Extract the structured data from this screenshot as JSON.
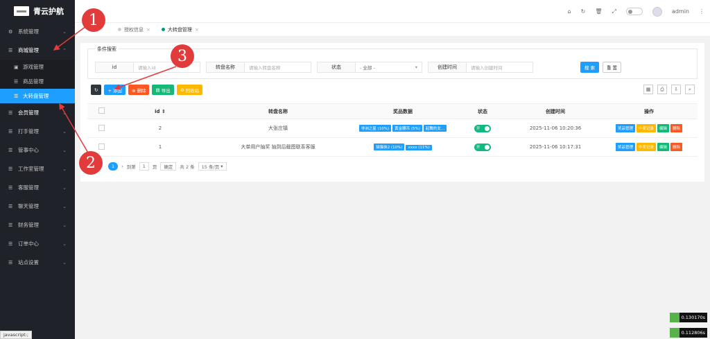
{
  "sidebar": {
    "title": "青云护航",
    "items": [
      {
        "label": "系统管理",
        "icon": "gear-icon"
      },
      {
        "label": "商城管理",
        "icon": "list-icon"
      },
      {
        "label": "会员管理",
        "icon": "list-icon"
      },
      {
        "label": "打手管理",
        "icon": "list-icon"
      },
      {
        "label": "管事中心",
        "icon": "list-icon"
      },
      {
        "label": "工作室管理",
        "icon": "list-icon"
      },
      {
        "label": "客服管理",
        "icon": "list-icon"
      },
      {
        "label": "聊天管理",
        "icon": "list-icon"
      },
      {
        "label": "财务管理",
        "icon": "list-icon"
      },
      {
        "label": "订单中心",
        "icon": "list-icon"
      },
      {
        "label": "站点设置",
        "icon": "list-icon"
      }
    ],
    "subitems": [
      {
        "label": "游戏管理"
      },
      {
        "label": "商品管理"
      },
      {
        "label": "大转盘管理"
      }
    ]
  },
  "topbar": {
    "user": "admin"
  },
  "tabs": [
    {
      "label": "授权信息"
    },
    {
      "label": "大转盘管理"
    }
  ],
  "search": {
    "legend": "条件搜索",
    "id_label": "id",
    "id_placeholder": "请输入id",
    "name_label": "转盘名称",
    "name_placeholder": "请输入转盘名称",
    "status_label": "状态",
    "status_value": "- 全部 -",
    "time_label": "创建时间",
    "time_placeholder": "请输入创建时间",
    "search_btn": "搜 索",
    "reset_btn": "重 置"
  },
  "toolbar": {
    "add": "+ 添加",
    "delete": "⊗ 删除",
    "export": "导出",
    "recycle": "回收站"
  },
  "table": {
    "headers": [
      "id ⇕",
      "转盘名称",
      "奖品数据",
      "状态",
      "创建时间",
      "操作"
    ],
    "rows": [
      {
        "id": "2",
        "name": "大张庄镇",
        "prizes": [
          "非洲之星 (10%)",
          "黄金腰吊 (5%)",
          "起舞的女..."
        ],
        "status": "开",
        "time": "2025-11-06 10:20:36"
      },
      {
        "id": "1",
        "name": "大单用户抽奖 抽到后截图联系客服",
        "prizes": [
          "猫猫侠2 (10%)",
          "xxxx (11%)"
        ],
        "status": "开",
        "time": "2025-11-06 10:17:31"
      }
    ],
    "ops": [
      "奖品管理",
      "中奖记录",
      "编辑",
      "删除"
    ]
  },
  "pager": {
    "page": "1",
    "goto_label": "到第",
    "goto_value": "1",
    "page_unit": "页",
    "confirm": "确定",
    "total": "共 2 条",
    "per_page": "15 条/页"
  },
  "annotations": [
    "1",
    "2",
    "3"
  ],
  "statusbar": "javascript:;",
  "timings": [
    "0.130170s",
    "0.112806s"
  ],
  "colors": {
    "accent": "#1e9fff",
    "sidebar": "#20222a",
    "danger": "#ff5722",
    "warning": "#ffb800",
    "success": "#16b777",
    "annotation": "#e23b3b"
  }
}
